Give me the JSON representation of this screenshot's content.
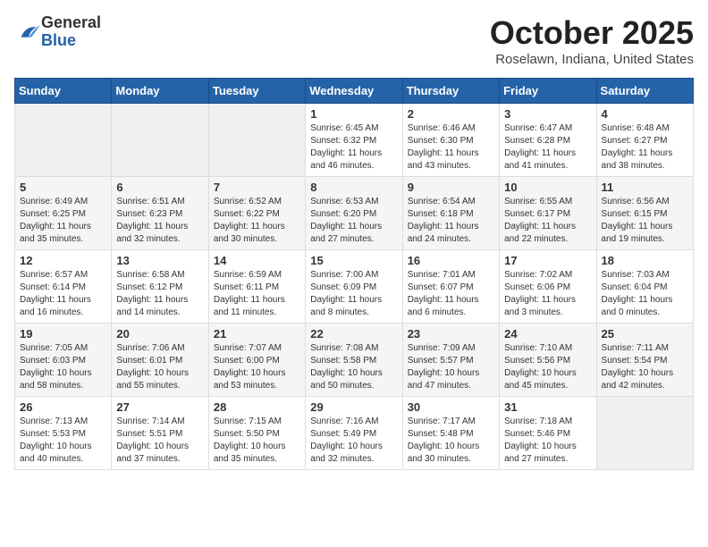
{
  "header": {
    "logo_general": "General",
    "logo_blue": "Blue",
    "month_title": "October 2025",
    "location": "Roselawn, Indiana, United States"
  },
  "days_of_week": [
    "Sunday",
    "Monday",
    "Tuesday",
    "Wednesday",
    "Thursday",
    "Friday",
    "Saturday"
  ],
  "weeks": [
    [
      {
        "day": "",
        "info": ""
      },
      {
        "day": "",
        "info": ""
      },
      {
        "day": "",
        "info": ""
      },
      {
        "day": "1",
        "info": "Sunrise: 6:45 AM\nSunset: 6:32 PM\nDaylight: 11 hours\nand 46 minutes."
      },
      {
        "day": "2",
        "info": "Sunrise: 6:46 AM\nSunset: 6:30 PM\nDaylight: 11 hours\nand 43 minutes."
      },
      {
        "day": "3",
        "info": "Sunrise: 6:47 AM\nSunset: 6:28 PM\nDaylight: 11 hours\nand 41 minutes."
      },
      {
        "day": "4",
        "info": "Sunrise: 6:48 AM\nSunset: 6:27 PM\nDaylight: 11 hours\nand 38 minutes."
      }
    ],
    [
      {
        "day": "5",
        "info": "Sunrise: 6:49 AM\nSunset: 6:25 PM\nDaylight: 11 hours\nand 35 minutes."
      },
      {
        "day": "6",
        "info": "Sunrise: 6:51 AM\nSunset: 6:23 PM\nDaylight: 11 hours\nand 32 minutes."
      },
      {
        "day": "7",
        "info": "Sunrise: 6:52 AM\nSunset: 6:22 PM\nDaylight: 11 hours\nand 30 minutes."
      },
      {
        "day": "8",
        "info": "Sunrise: 6:53 AM\nSunset: 6:20 PM\nDaylight: 11 hours\nand 27 minutes."
      },
      {
        "day": "9",
        "info": "Sunrise: 6:54 AM\nSunset: 6:18 PM\nDaylight: 11 hours\nand 24 minutes."
      },
      {
        "day": "10",
        "info": "Sunrise: 6:55 AM\nSunset: 6:17 PM\nDaylight: 11 hours\nand 22 minutes."
      },
      {
        "day": "11",
        "info": "Sunrise: 6:56 AM\nSunset: 6:15 PM\nDaylight: 11 hours\nand 19 minutes."
      }
    ],
    [
      {
        "day": "12",
        "info": "Sunrise: 6:57 AM\nSunset: 6:14 PM\nDaylight: 11 hours\nand 16 minutes."
      },
      {
        "day": "13",
        "info": "Sunrise: 6:58 AM\nSunset: 6:12 PM\nDaylight: 11 hours\nand 14 minutes."
      },
      {
        "day": "14",
        "info": "Sunrise: 6:59 AM\nSunset: 6:11 PM\nDaylight: 11 hours\nand 11 minutes."
      },
      {
        "day": "15",
        "info": "Sunrise: 7:00 AM\nSunset: 6:09 PM\nDaylight: 11 hours\nand 8 minutes."
      },
      {
        "day": "16",
        "info": "Sunrise: 7:01 AM\nSunset: 6:07 PM\nDaylight: 11 hours\nand 6 minutes."
      },
      {
        "day": "17",
        "info": "Sunrise: 7:02 AM\nSunset: 6:06 PM\nDaylight: 11 hours\nand 3 minutes."
      },
      {
        "day": "18",
        "info": "Sunrise: 7:03 AM\nSunset: 6:04 PM\nDaylight: 11 hours\nand 0 minutes."
      }
    ],
    [
      {
        "day": "19",
        "info": "Sunrise: 7:05 AM\nSunset: 6:03 PM\nDaylight: 10 hours\nand 58 minutes."
      },
      {
        "day": "20",
        "info": "Sunrise: 7:06 AM\nSunset: 6:01 PM\nDaylight: 10 hours\nand 55 minutes."
      },
      {
        "day": "21",
        "info": "Sunrise: 7:07 AM\nSunset: 6:00 PM\nDaylight: 10 hours\nand 53 minutes."
      },
      {
        "day": "22",
        "info": "Sunrise: 7:08 AM\nSunset: 5:58 PM\nDaylight: 10 hours\nand 50 minutes."
      },
      {
        "day": "23",
        "info": "Sunrise: 7:09 AM\nSunset: 5:57 PM\nDaylight: 10 hours\nand 47 minutes."
      },
      {
        "day": "24",
        "info": "Sunrise: 7:10 AM\nSunset: 5:56 PM\nDaylight: 10 hours\nand 45 minutes."
      },
      {
        "day": "25",
        "info": "Sunrise: 7:11 AM\nSunset: 5:54 PM\nDaylight: 10 hours\nand 42 minutes."
      }
    ],
    [
      {
        "day": "26",
        "info": "Sunrise: 7:13 AM\nSunset: 5:53 PM\nDaylight: 10 hours\nand 40 minutes."
      },
      {
        "day": "27",
        "info": "Sunrise: 7:14 AM\nSunset: 5:51 PM\nDaylight: 10 hours\nand 37 minutes."
      },
      {
        "day": "28",
        "info": "Sunrise: 7:15 AM\nSunset: 5:50 PM\nDaylight: 10 hours\nand 35 minutes."
      },
      {
        "day": "29",
        "info": "Sunrise: 7:16 AM\nSunset: 5:49 PM\nDaylight: 10 hours\nand 32 minutes."
      },
      {
        "day": "30",
        "info": "Sunrise: 7:17 AM\nSunset: 5:48 PM\nDaylight: 10 hours\nand 30 minutes."
      },
      {
        "day": "31",
        "info": "Sunrise: 7:18 AM\nSunset: 5:46 PM\nDaylight: 10 hours\nand 27 minutes."
      },
      {
        "day": "",
        "info": ""
      }
    ]
  ]
}
